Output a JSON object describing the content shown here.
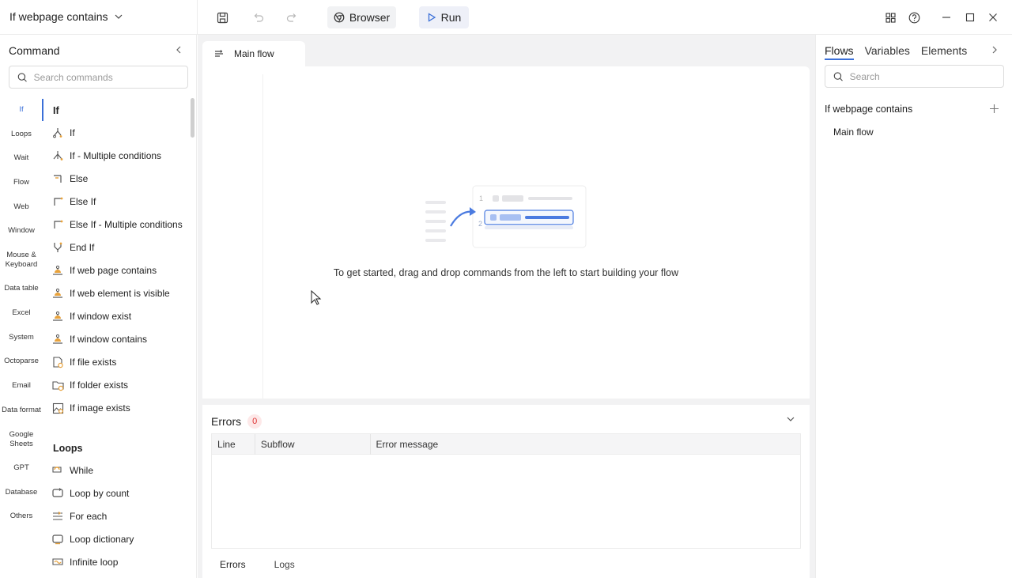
{
  "topbar": {
    "project_title": "If webpage contains",
    "browser_label": "Browser",
    "run_label": "Run"
  },
  "left_panel": {
    "title": "Command",
    "search_placeholder": "Search commands",
    "categories": [
      "If",
      "Loops",
      "Wait",
      "Flow",
      "Web",
      "Window",
      "Mouse & Keyboard",
      "Data table",
      "Excel",
      "System",
      "Octoparse",
      "Email",
      "Data format",
      "Google Sheets",
      "GPT",
      "Database",
      "Others"
    ],
    "groups": [
      {
        "label": "If",
        "items": [
          "If",
          "If - Multiple conditions",
          "Else",
          "Else If",
          "Else If - Multiple conditions",
          "End If",
          "If web page contains",
          "If web element is visible",
          "If window exist",
          "If window contains",
          "If file exists",
          "If folder exists",
          "If image exists"
        ]
      },
      {
        "label": "Loops",
        "items": [
          "While",
          "Loop by count",
          "For each",
          "Loop dictionary",
          "Infinite loop"
        ]
      }
    ]
  },
  "center": {
    "tab_label": "Main flow",
    "empty_message": "To get started, drag and drop commands from the left to start building your flow",
    "errors": {
      "title": "Errors",
      "count": "0",
      "columns": [
        "Line",
        "Subflow",
        "Error message"
      ],
      "tabs": [
        "Errors",
        "Logs"
      ]
    }
  },
  "right_panel": {
    "tabs": [
      "Flows",
      "Variables",
      "Elements"
    ],
    "search_placeholder": "Search",
    "flow_group": "If webpage contains",
    "flows": [
      "Main flow"
    ]
  },
  "colors": {
    "accent": "#3a6fd8",
    "error_badge": "#d33"
  }
}
